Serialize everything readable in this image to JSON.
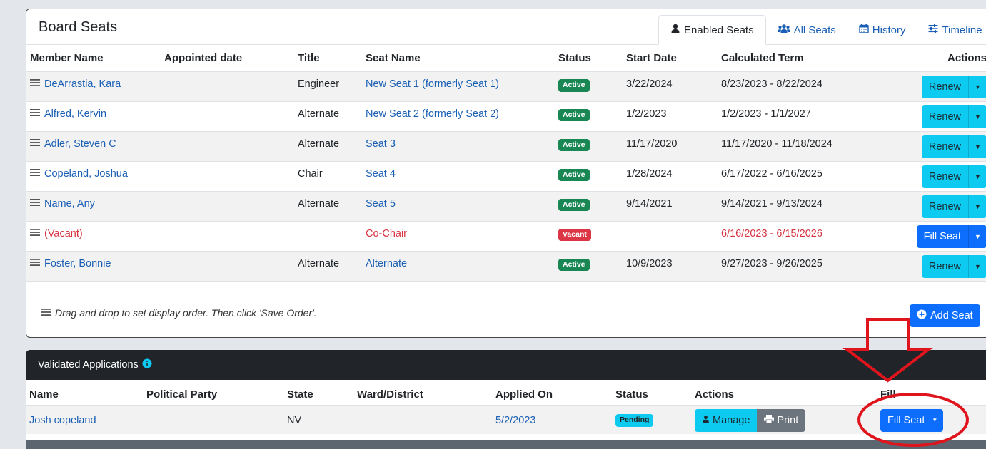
{
  "board": {
    "title": "Board Seats",
    "tabs": [
      {
        "label": "Enabled Seats",
        "icon": "user-icon",
        "active": true
      },
      {
        "label": "All Seats",
        "icon": "users-icon",
        "active": false
      },
      {
        "label": "History",
        "icon": "calendar-icon",
        "active": false
      },
      {
        "label": "Timeline",
        "icon": "sliders-icon",
        "active": false
      }
    ],
    "columns": [
      "Member Name",
      "Appointed date",
      "Title",
      "Seat Name",
      "Status",
      "Start Date",
      "Calculated Term",
      "Actions"
    ],
    "rows": [
      {
        "member": "DeArrastia, Kara",
        "appointed": "",
        "title": "Engineer",
        "seat": "New Seat 1 (formerly Seat 1)",
        "status": "Active",
        "start": "3/22/2024",
        "term": "8/23/2023 - 8/22/2024",
        "action": "Renew"
      },
      {
        "member": "Alfred, Kervin",
        "appointed": "",
        "title": "Alternate",
        "seat": "New Seat 2 (formerly Seat 2)",
        "status": "Active",
        "start": "1/2/2023",
        "term": "1/2/2023 - 1/1/2027",
        "action": "Renew"
      },
      {
        "member": "Adler, Steven C",
        "appointed": "",
        "title": "Alternate",
        "seat": "Seat 3",
        "status": "Active",
        "start": "11/17/2020",
        "term": "11/17/2020 - 11/18/2024",
        "action": "Renew"
      },
      {
        "member": "Copeland, Joshua",
        "appointed": "",
        "title": "Chair",
        "seat": "Seat 4",
        "status": "Active",
        "start": "1/28/2024",
        "term": "6/17/2022 - 6/16/2025",
        "action": "Renew"
      },
      {
        "member": "Name, Any",
        "appointed": "",
        "title": "Alternate",
        "seat": "Seat 5",
        "status": "Active",
        "start": "9/14/2021",
        "term": "9/14/2021 - 9/13/2024",
        "action": "Renew"
      },
      {
        "member": "(Vacant)",
        "appointed": "",
        "title": "",
        "seat": "Co-Chair",
        "status": "Vacant",
        "start": "",
        "term": "6/16/2023 - 6/15/2026",
        "action": "Fill Seat"
      },
      {
        "member": "Foster, Bonnie",
        "appointed": "",
        "title": "Alternate",
        "seat": "Alternate",
        "status": "Active",
        "start": "10/9/2023",
        "term": "9/27/2023 - 9/26/2025",
        "action": "Renew"
      }
    ],
    "drag_note": "Drag and drop to set display order. Then click 'Save Order'.",
    "add_seat_label": "Add Seat"
  },
  "applications": {
    "title": "Validated Applications",
    "columns": [
      "Name",
      "Political Party",
      "State",
      "Ward/District",
      "Applied On",
      "Status",
      "Actions",
      "Fill"
    ],
    "rows": [
      {
        "name": "Josh copeland",
        "party": "",
        "state": "NV",
        "ward": "",
        "applied": "5/2/2023",
        "status": "Pending",
        "manage": "Manage",
        "print": "Print",
        "fill": "Fill Seat"
      }
    ]
  },
  "colors": {
    "primary": "#0d6efd",
    "info": "#0dcaf0",
    "success": "#198754",
    "danger": "#dc3545",
    "annotation": "#e0141c"
  }
}
